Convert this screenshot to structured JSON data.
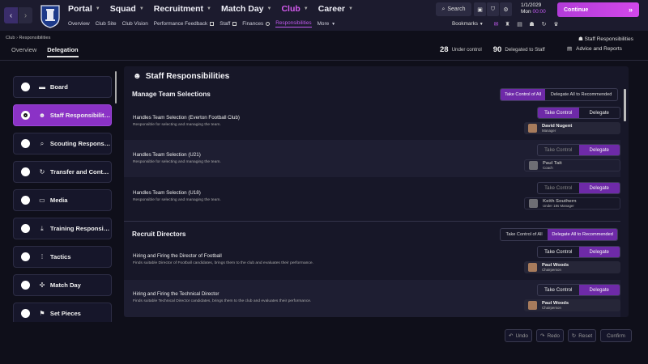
{
  "topbar": {
    "main_menu": [
      "Portal",
      "Squad",
      "Recruitment",
      "Match Day",
      "Club",
      "Career"
    ],
    "active_main": "Club",
    "sub_menu": [
      "Overview",
      "Club Site",
      "Club Vision",
      "Performance Feedback",
      "Staff",
      "Finances",
      "Responsibilities",
      "More"
    ],
    "active_sub": "Responsibilities",
    "search_label": "Search",
    "date": "1/1/2029",
    "day_time_day": "Mon",
    "day_time_time": "00:00",
    "continue_label": "Continue",
    "bookmarks_label": "Bookmarks",
    "accent_color": "#c25af0"
  },
  "header": {
    "breadcrumb_club": "Club",
    "breadcrumb_current": "Responsibilities",
    "tabs": [
      "Overview",
      "Delegation"
    ],
    "active_tab": "Delegation",
    "staff_resp_link": "Staff Responsibilities",
    "under_control_count": "28",
    "under_control_label": "Under control",
    "delegated_count": "90",
    "delegated_label": "Delegated to Staff",
    "advice_label": "Advice and Reports"
  },
  "sidebar": {
    "items": [
      {
        "label": "Board",
        "icon": "briefcase-icon"
      },
      {
        "label": "Staff Responsibilities",
        "icon": "person-icon"
      },
      {
        "label": "Scouting Responsibilities",
        "icon": "magnifier-icon"
      },
      {
        "label": "Transfer and Contract",
        "icon": "transfer-icon"
      },
      {
        "label": "Media",
        "icon": "monitor-icon"
      },
      {
        "label": "Training Responsibilities",
        "icon": "download-icon"
      },
      {
        "label": "Tactics",
        "icon": "tactics-icon"
      },
      {
        "label": "Match Day",
        "icon": "match-icon"
      },
      {
        "label": "Set Pieces",
        "icon": "flag-icon"
      }
    ],
    "active_index": 1
  },
  "panel": {
    "title": "Staff Responsibilities",
    "take_control_all": "Take Control of All",
    "delegate_all": "Delegate All to Recommended",
    "take_control": "Take Control",
    "delegate": "Delegate",
    "sections": [
      {
        "title": "Manage Team Selections",
        "rows": [
          {
            "title": "Handles Team Selection (Everton Football Club)",
            "desc": "Responsible for selecting and managing the team.",
            "state": "control",
            "person": "David Nugent",
            "role": "Manager"
          },
          {
            "title": "Handles Team Selection (U21)",
            "desc": "Responsible for selecting and managing the team.",
            "state": "delegate",
            "person": "Paul Tait",
            "role": "Coach"
          },
          {
            "title": "Handles Team Selection (U18)",
            "desc": "Responsible for selecting and managing the team.",
            "state": "delegate",
            "person": "Keith Southern",
            "role": "Under 18s Manager"
          }
        ]
      },
      {
        "title": "Recruit Directors",
        "rows": [
          {
            "title": "Hiring and Firing the Director of Football",
            "desc": "Finds suitable Director of Football candidates, brings them to the club and evaluates their performance.",
            "state": "control",
            "person": "Paul Woods",
            "role": "Chairperson"
          },
          {
            "title": "Hiring and Firing the Technical Director",
            "desc": "Finds suitable Technical Director candidates, brings them to the club and evaluates their performance.",
            "state": "control",
            "person": "Paul Woods",
            "role": "Chairperson"
          }
        ]
      }
    ]
  },
  "footer": {
    "undo": "Undo",
    "redo": "Redo",
    "reset": "Reset",
    "confirm": "Confirm"
  }
}
